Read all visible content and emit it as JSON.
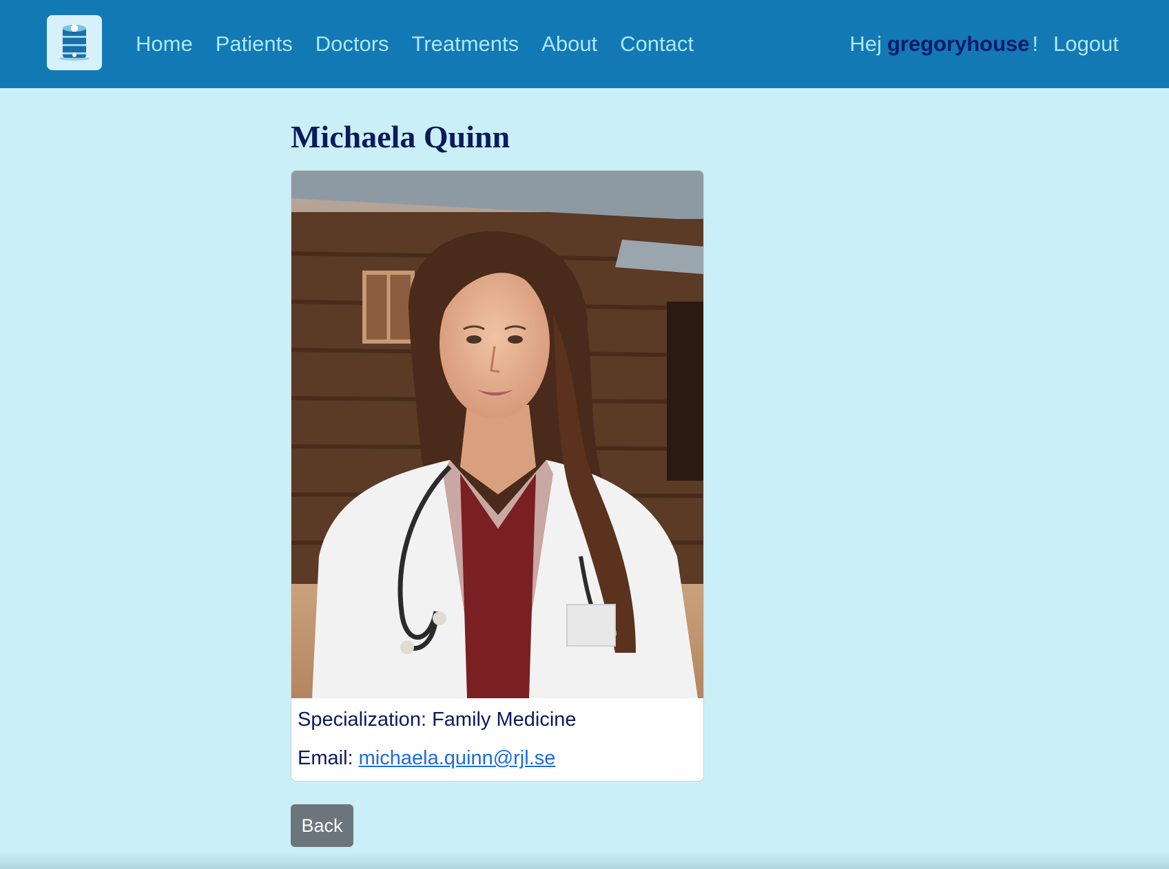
{
  "nav": {
    "logo_icon": "hospital-database-icon",
    "links": [
      "Home",
      "Patients",
      "Doctors",
      "Treatments",
      "About",
      "Contact"
    ],
    "greeting": "Hej",
    "username": "gregoryhouse",
    "exclamation": "!",
    "logout": "Logout"
  },
  "doctor": {
    "name": "Michaela Quinn",
    "photo_icon": "doctor-portrait-photo",
    "specialization_label": "Specialization:",
    "specialization": "Family Medicine",
    "email_label": "Email:",
    "email": "michaela.quinn@rjl.se"
  },
  "back_label": "Back",
  "colors": {
    "navbar": "#1279b5",
    "background": "#cbeff7",
    "heading": "#0b1a5c",
    "link": "#1a6be0",
    "button": "#6c757d"
  }
}
